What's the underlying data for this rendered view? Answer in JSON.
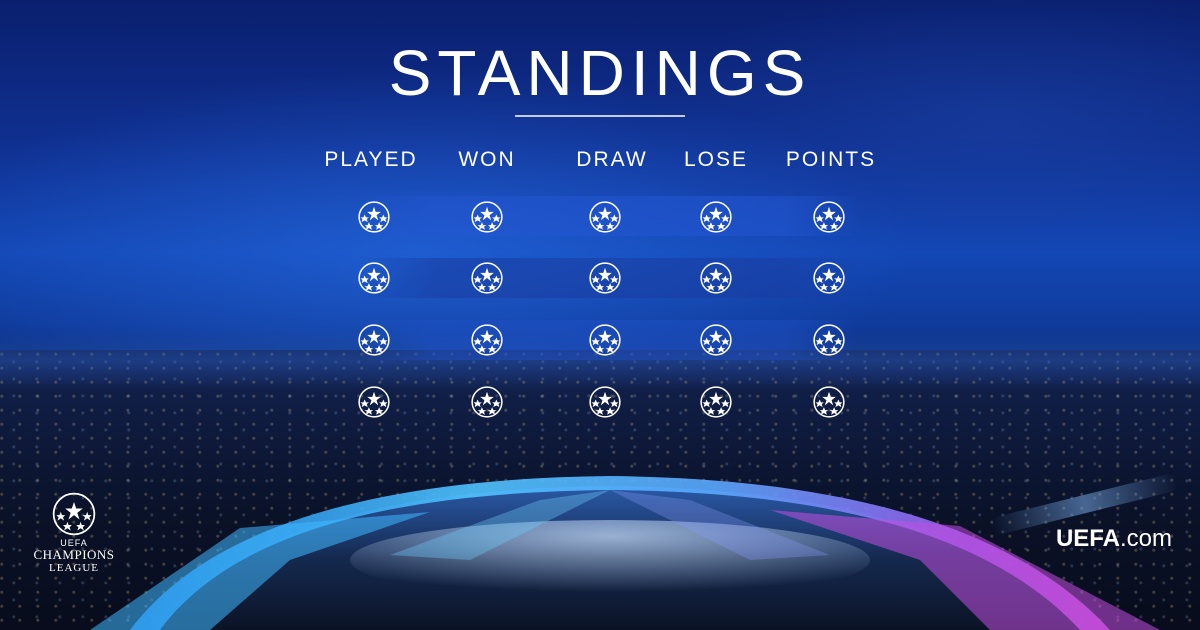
{
  "title": "STANDINGS",
  "columns": [
    "PLAYED",
    "WON",
    "DRAW",
    "LOSE",
    "POINTS"
  ],
  "rows": 4,
  "ball_icon": "starball-icon",
  "logo": {
    "name": "uefa-champions-league-logo",
    "top": "UEFA",
    "line1": "CHAMPIONS",
    "line2": "LEAGUE"
  },
  "brand": {
    "bold": "UEFA",
    "rest": ".com"
  },
  "colors": {
    "text": "#ffffff",
    "sky_top": "#0a1f6e",
    "sky_glow": "#1347b5",
    "arena_cyan": "#3fb8ff",
    "arena_magenta": "#d24bd8"
  }
}
